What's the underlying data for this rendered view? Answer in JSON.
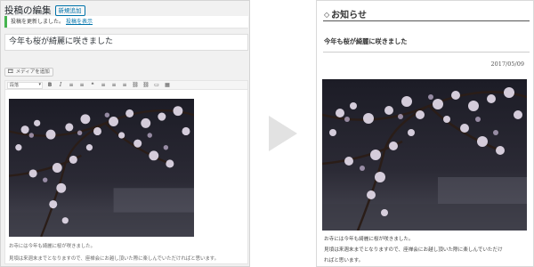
{
  "editor": {
    "title": "投稿の編集",
    "add_new_label": "新規追加",
    "notice": {
      "text": "投稿を更新しました。",
      "link": "投稿を表示"
    },
    "post_title_value": "今年も桜が綺麗に咲きました",
    "media_button_label": "メディアを追加",
    "toolbar": {
      "format_select": "段落",
      "buttons": [
        "B",
        "I",
        "≡",
        "≡",
        "❝",
        "≡",
        "≡",
        "≡",
        "⛓",
        "⛓",
        "▭",
        "▦"
      ]
    },
    "body_lines": [
      "お寺には今年も綺麗に桜が咲きました。",
      "見頃は来週末までとなりますので、座禅会にお越し頂いた際に楽しんでいただければと思います。"
    ]
  },
  "preview": {
    "section_heading": "お知らせ",
    "post_title": "今年も桜が綺麗に咲きました",
    "date": "2017/05/09",
    "body_lines": [
      "お寺には今年も綺麗に桜が咲きました。",
      "見頃は来週末までとなりますので、座禅会にお越し頂いた際に楽しんでいただけ",
      "ればと思います。"
    ]
  },
  "colors": {
    "accent": "#0073aa",
    "notice_border": "#46b450",
    "arrow": "#e2e2e2"
  }
}
